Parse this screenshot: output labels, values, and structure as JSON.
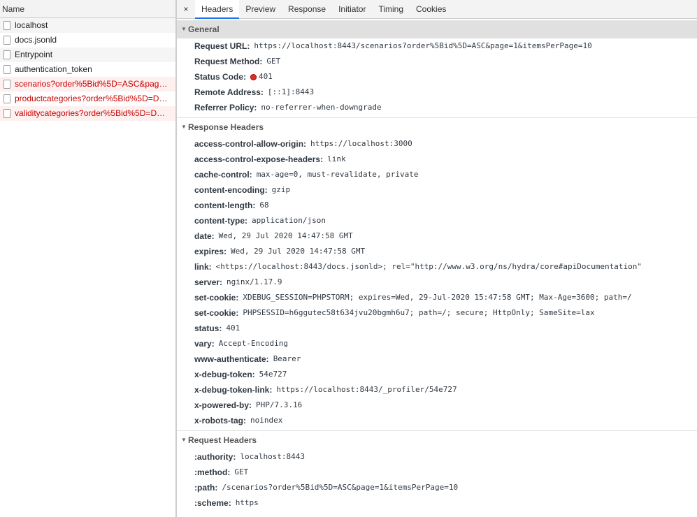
{
  "list": {
    "header": "Name",
    "items": [
      {
        "name": "localhost",
        "error": false
      },
      {
        "name": "docs.jsonld",
        "error": false
      },
      {
        "name": "Entrypoint",
        "error": false
      },
      {
        "name": "authentication_token",
        "error": false
      },
      {
        "name": "scenarios?order%5Bid%5D=ASC&page…",
        "error": true
      },
      {
        "name": "productcategories?order%5Bid%5D=D…",
        "error": true
      },
      {
        "name": "validitycategories?order%5Bid%5D=D…",
        "error": true
      }
    ]
  },
  "tabs": {
    "close": "×",
    "items": [
      "Headers",
      "Preview",
      "Response",
      "Initiator",
      "Timing",
      "Cookies"
    ],
    "active": "Headers"
  },
  "general": {
    "title": "General",
    "rows": [
      {
        "k": "Request URL:",
        "v": "https://localhost:8443/scenarios?order%5Bid%5D=ASC&page=1&itemsPerPage=10"
      },
      {
        "k": "Request Method:",
        "v": "GET"
      },
      {
        "k": "Status Code:",
        "v": "401"
      },
      {
        "k": "Remote Address:",
        "v": "[::1]:8443"
      },
      {
        "k": "Referrer Policy:",
        "v": "no-referrer-when-downgrade"
      }
    ]
  },
  "response_headers": {
    "title": "Response Headers",
    "rows": [
      {
        "k": "access-control-allow-origin:",
        "v": "https://localhost:3000"
      },
      {
        "k": "access-control-expose-headers:",
        "v": "link"
      },
      {
        "k": "cache-control:",
        "v": "max-age=0, must-revalidate, private"
      },
      {
        "k": "content-encoding:",
        "v": "gzip"
      },
      {
        "k": "content-length:",
        "v": "68"
      },
      {
        "k": "content-type:",
        "v": "application/json"
      },
      {
        "k": "date:",
        "v": "Wed, 29 Jul 2020 14:47:58 GMT"
      },
      {
        "k": "expires:",
        "v": "Wed, 29 Jul 2020 14:47:58 GMT"
      },
      {
        "k": "link:",
        "v": "<https://localhost:8443/docs.jsonld>; rel=\"http://www.w3.org/ns/hydra/core#apiDocumentation\""
      },
      {
        "k": "server:",
        "v": "nginx/1.17.9"
      },
      {
        "k": "set-cookie:",
        "v": "XDEBUG_SESSION=PHPSTORM; expires=Wed, 29-Jul-2020 15:47:58 GMT; Max-Age=3600; path=/"
      },
      {
        "k": "set-cookie:",
        "v": "PHPSESSID=h6ggutec58t634jvu20bgmh6u7; path=/; secure; HttpOnly; SameSite=lax"
      },
      {
        "k": "status:",
        "v": "401"
      },
      {
        "k": "vary:",
        "v": "Accept-Encoding"
      },
      {
        "k": "www-authenticate:",
        "v": "Bearer"
      },
      {
        "k": "x-debug-token:",
        "v": "54e727"
      },
      {
        "k": "x-debug-token-link:",
        "v": "https://localhost:8443/_profiler/54e727"
      },
      {
        "k": "x-powered-by:",
        "v": "PHP/7.3.16"
      },
      {
        "k": "x-robots-tag:",
        "v": "noindex"
      }
    ]
  },
  "request_headers": {
    "title": "Request Headers",
    "rows": [
      {
        "k": ":authority:",
        "v": "localhost:8443"
      },
      {
        "k": ":method:",
        "v": "GET"
      },
      {
        "k": ":path:",
        "v": "/scenarios?order%5Bid%5D=ASC&page=1&itemsPerPage=10"
      },
      {
        "k": ":scheme:",
        "v": "https"
      }
    ]
  },
  "colors": {
    "accent": "#1a73e8",
    "error_text": "#c80000",
    "status_dot": "#d93025"
  },
  "icons": {
    "file": "file-icon",
    "expand": "triangle-down-icon",
    "close": "close-icon",
    "status": "status-error-dot-icon"
  }
}
